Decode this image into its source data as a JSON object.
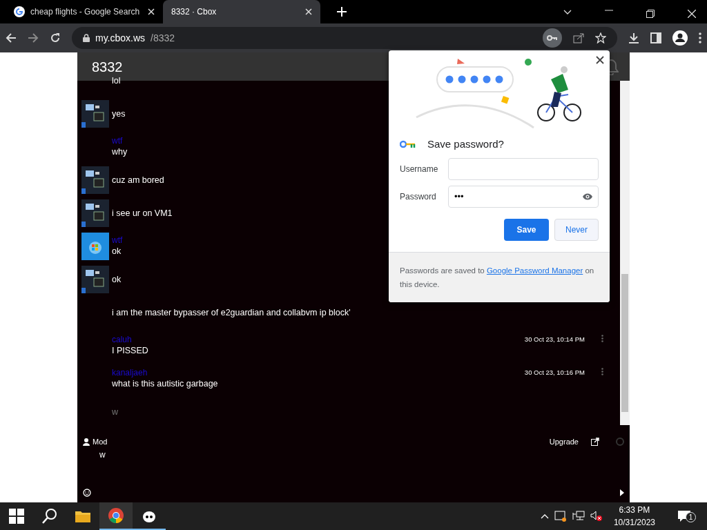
{
  "browser": {
    "tabs": [
      {
        "title": "cheap flights - Google Search",
        "selected": false,
        "kind": "google"
      },
      {
        "title": "8332 · Cbox",
        "selected": true,
        "kind": "plain"
      }
    ],
    "url_host": "my.cbox.ws",
    "url_path": "/8332"
  },
  "chat": {
    "title": "8332",
    "messages": [
      {
        "kind": "text",
        "text": "lol",
        "faded": false
      },
      {
        "kind": "screen",
        "text": "yes",
        "faded": false
      },
      {
        "kind": "text",
        "name": "wtf",
        "text": "why",
        "faded": false
      },
      {
        "kind": "screen",
        "text": "cuz am bored",
        "faded": false
      },
      {
        "kind": "screen",
        "text": "i see ur on VM1",
        "faded": false
      },
      {
        "kind": "windows",
        "name": "wtf",
        "text": "ok",
        "faded": false
      },
      {
        "kind": "screen",
        "text": "ok",
        "faded": false
      },
      {
        "kind": "text",
        "text": "i am the master bypasser of e2guardian and collabvm ip block'",
        "faded": false
      },
      {
        "kind": "text",
        "name": "caluh",
        "text": "I PISSED",
        "time": "30 Oct 23, 10:14 PM",
        "faded": false
      },
      {
        "kind": "text",
        "name": "kanaljaeh",
        "text": "what is this autistic garbage",
        "time": "30 Oct 23, 10:16 PM",
        "faded": false
      },
      {
        "kind": "text",
        "text": "w",
        "faded": true
      }
    ],
    "user_label": "Mod",
    "upgrade": "Upgrade",
    "input_value": "w"
  },
  "popup": {
    "title": "Save password?",
    "username_label": "Username",
    "password_label": "Password",
    "password_value": "•••",
    "save": "Save",
    "never": "Never",
    "footer": "Passwords are saved to ",
    "footer_link": "Google Password Manager",
    "footer_end": " on this device."
  },
  "taskbar": {
    "time": "6:33 PM",
    "date": "10/31/2023",
    "notifications": "1"
  }
}
